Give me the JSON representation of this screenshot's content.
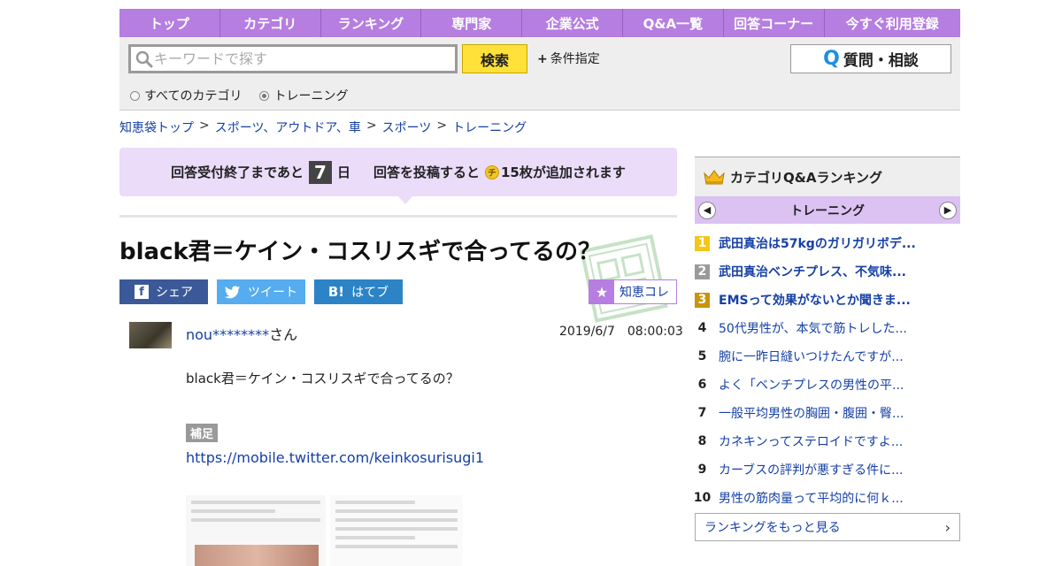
{
  "nav": [
    "トップ",
    "カテゴリ",
    "ランキング",
    "専門家",
    "企業公式",
    "Q&A一覧",
    "回答コーナー",
    "今すぐ利用登録"
  ],
  "search": {
    "placeholder": "キーワードで探す",
    "button": "検索",
    "conditions": "条件指定",
    "ask_button": "質問・相談"
  },
  "scope": {
    "all": "すべてのカテゴリ",
    "current": "トレーニング",
    "selected": "current"
  },
  "breadcrumb": [
    "知恵袋トップ",
    "スポーツ、アウトドア、車",
    "スポーツ",
    "トレーニング"
  ],
  "banner": {
    "prefix": "回答受付終了まであと",
    "days": "7",
    "day_unit": "日",
    "mid": "回答を投稿すると",
    "coin_label": "チ",
    "suffix": "15枚が追加されます"
  },
  "question": {
    "title": "black君＝ケイン・コスリスギで合ってるの？",
    "asker": "nou********",
    "asker_suffix": "さん",
    "posted": "2019/6/7　08:00:03",
    "body": "black君＝ケイン・コスリスギで合ってるの？",
    "supplement_label": "補足",
    "supplement_link": "https://mobile.twitter.com/keinkosurisugi1"
  },
  "share": {
    "facebook": "シェア",
    "twitter": "ツイート",
    "hatena": "はてブ",
    "hatena_mark": "B!",
    "collect": "知恵コレ"
  },
  "ranking": {
    "heading": "カテゴリQ&Aランキング",
    "category": "トレーニング",
    "items": [
      {
        "rank": "1",
        "title": "武田真治は57kgのガリガリボデ..."
      },
      {
        "rank": "2",
        "title": "武田真治ベンチプレス、不気味..."
      },
      {
        "rank": "3",
        "title": "EMSって効果がないとか聞きま..."
      },
      {
        "rank": "4",
        "title": "50代男性が、本気で筋トレした..."
      },
      {
        "rank": "5",
        "title": "腕に一昨日縫いつけたんですが..."
      },
      {
        "rank": "6",
        "title": "よく「ベンチプレスの男性の平..."
      },
      {
        "rank": "7",
        "title": "一般平均男性の胸囲・腹囲・臀..."
      },
      {
        "rank": "8",
        "title": "カネキンってステロイドですよ..."
      },
      {
        "rank": "9",
        "title": "カーブスの評判が悪すぎる件に..."
      },
      {
        "rank": "10",
        "title": "男性の筋肉量って平均的に何ｋ..."
      }
    ],
    "more": "ランキングをもっと見る"
  },
  "colors": {
    "brand": "#b57ee0",
    "banner": "#ebdcfa",
    "link": "#1640a6",
    "search_button": "#ffe13a"
  }
}
